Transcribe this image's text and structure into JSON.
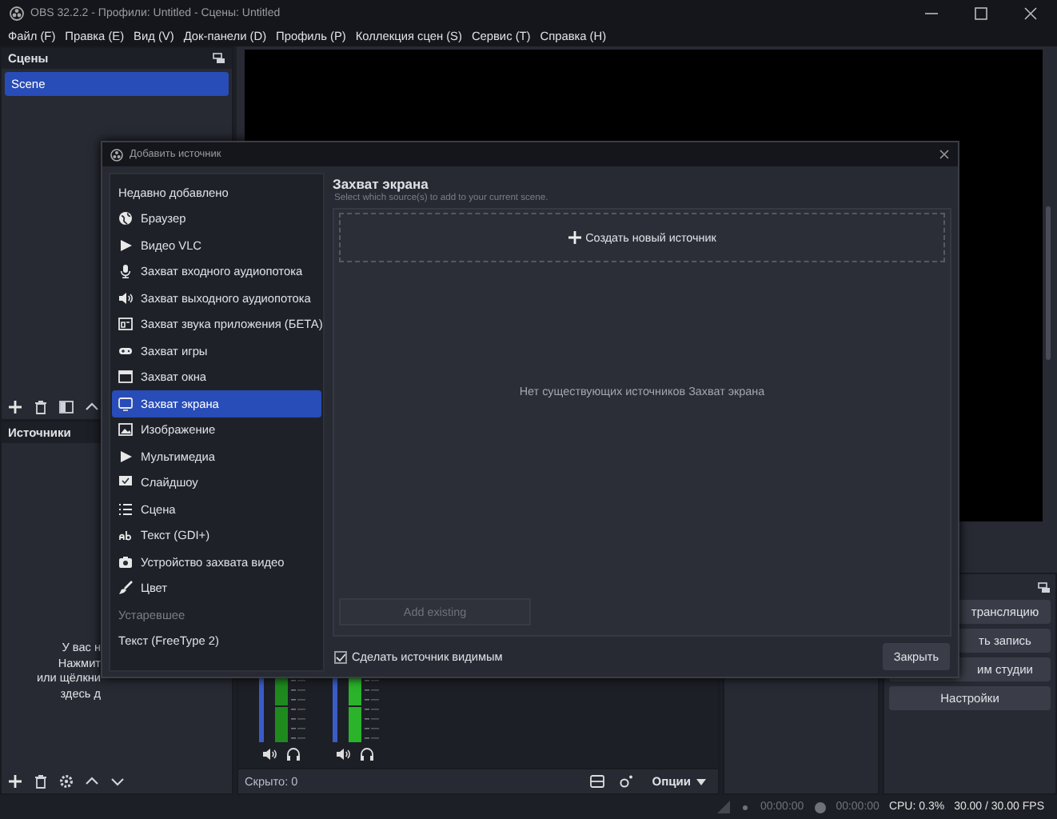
{
  "window": {
    "title": "OBS 32.2.2 - Профили: Untitled - Сцены: Untitled"
  },
  "menu": [
    "Файл (F)",
    "Правка (E)",
    "Вид (V)",
    "Док-панели (D)",
    "Профиль (P)",
    "Коллекция сцен (S)",
    "Сервис (T)",
    "Справка (H)"
  ],
  "scenes": {
    "title": "Сцены",
    "items": [
      {
        "label": "Scene",
        "selected": true
      }
    ]
  },
  "sources": {
    "title": "Источники",
    "empty_text": [
      "У вас н",
      "Нажмит",
      "или щёлкни",
      "здесь д"
    ]
  },
  "mixer": {
    "hidden_count": "Скрыто: 0",
    "options_button": "Опции"
  },
  "controls": {
    "buttons": [
      "трансляцию",
      "ть запись",
      "им студии",
      "Настройки"
    ]
  },
  "status_bar": {
    "stream_time": "00:00:00",
    "record_time": "00:00:00",
    "cpu": "CPU: 0.3%",
    "fps": "30.00 / 30.00 FPS"
  },
  "dialog": {
    "title": "Добавить источник",
    "source_types": [
      {
        "label": "Недавно добавлено",
        "kind": "item",
        "selected": false
      },
      {
        "label": "Браузер",
        "kind": "item",
        "selected": false
      },
      {
        "label": "Видео VLC",
        "kind": "item",
        "selected": false
      },
      {
        "label": "Захват входного аудиопотока",
        "kind": "item",
        "selected": false
      },
      {
        "label": "Захват выходного аудиопотока",
        "kind": "item",
        "selected": false
      },
      {
        "label": "Захват звука приложения (БЕТА)",
        "kind": "item",
        "selected": false
      },
      {
        "label": "Захват игры",
        "kind": "item",
        "selected": false
      },
      {
        "label": "Захват окна",
        "kind": "item",
        "selected": false
      },
      {
        "label": "Захват экрана",
        "kind": "item",
        "selected": true
      },
      {
        "label": "Изображение",
        "kind": "item",
        "selected": false
      },
      {
        "label": "Мультимедиа",
        "kind": "item",
        "selected": false
      },
      {
        "label": "Слайдшоу",
        "kind": "item",
        "selected": false
      },
      {
        "label": "Сцена",
        "kind": "item",
        "selected": false
      },
      {
        "label": "Текст (GDI+)",
        "kind": "item",
        "selected": false
      },
      {
        "label": "Устройство захвата видео",
        "kind": "item",
        "selected": false
      },
      {
        "label": "Цвет",
        "kind": "item",
        "selected": false
      },
      {
        "label": "Устаревшее",
        "kind": "section"
      },
      {
        "label": "Текст (FreeType 2)",
        "kind": "item",
        "selected": false
      }
    ],
    "heading": "Захват экрана",
    "subtitle": "Select which source(s) to add to your current scene.",
    "create_new": "Создать новый источник",
    "empty_message": "Нет существующих источников Захват экрана",
    "add_existing": {
      "label": "Add existing",
      "disabled": true
    },
    "make_visible": {
      "label": "Сделать источник видимым",
      "checked": true
    },
    "close_button": "Закрыть"
  }
}
